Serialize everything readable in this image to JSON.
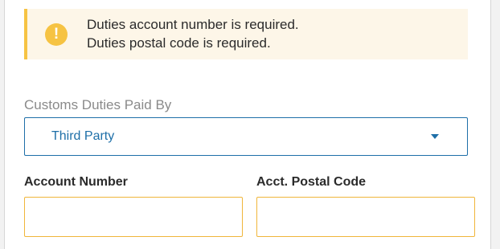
{
  "alert": {
    "icon": "warning-exclamation-icon",
    "messages": [
      "Duties account number is required.",
      "Duties postal code is required."
    ],
    "accent_color": "#f6c343",
    "background_color": "#fdf6e8"
  },
  "customs_duties": {
    "label": "Customs Duties Paid By",
    "selected_value": "Third Party",
    "caret_icon": "caret-down-icon",
    "accent_color": "#1e6fa8"
  },
  "account_number": {
    "label": "Account Number",
    "value": "",
    "border_color": "#f0b63b"
  },
  "postal_code": {
    "label": "Acct. Postal Code",
    "value": "",
    "border_color": "#f0b63b"
  }
}
